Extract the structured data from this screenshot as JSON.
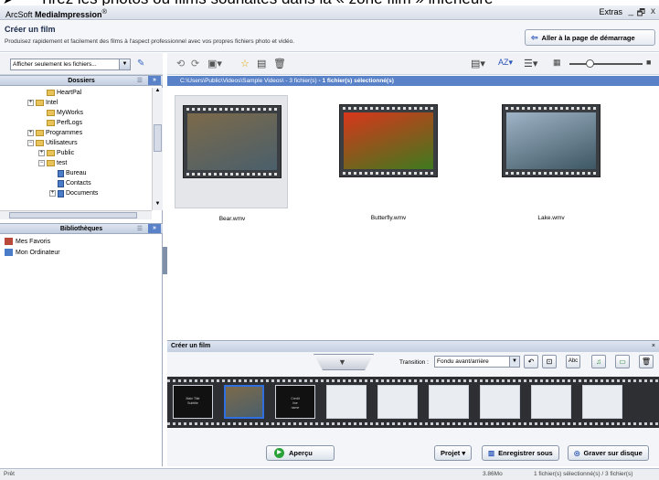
{
  "caption": {
    "bullet": "➤",
    "text": "Tirez les photos ou films souhaités dans la « zone film » inférieure"
  },
  "window": {
    "app_name_prefix": "ArcSoft ",
    "app_name_bold": "MediaImpression",
    "trademark": "®",
    "extras_label": "Extras",
    "minimize": "_",
    "restore": "🗗",
    "close": "x"
  },
  "header": {
    "title": "Créer un film",
    "subtitle": "Produisez rapidement et facilement des films à l'aspect professionnel avec vos propres fichiers photo et vidéo.",
    "home_button": "Aller à la page de démarrage"
  },
  "sidebar": {
    "filter_value": "Afficher seulement les fichiers...",
    "folders_title": "Dossiers",
    "tree": [
      {
        "label": "HeartPal",
        "expand": "",
        "icon": "folder"
      },
      {
        "label": "Intel",
        "expand": "+",
        "icon": "folder"
      },
      {
        "label": "MyWorks",
        "expand": "",
        "icon": "folder"
      },
      {
        "label": "PerfLogs",
        "expand": "",
        "icon": "folder"
      },
      {
        "label": "Programmes",
        "expand": "+",
        "icon": "folder"
      },
      {
        "label": "Utilisateurs",
        "expand": "−",
        "icon": "folder"
      },
      {
        "label": "Public",
        "expand": "+",
        "icon": "folder"
      },
      {
        "label": "test",
        "expand": "−",
        "icon": "folder"
      },
      {
        "label": "Bureau",
        "expand": "",
        "icon": "doc"
      },
      {
        "label": "Contacts",
        "expand": "",
        "icon": "doc"
      },
      {
        "label": "Documents",
        "expand": "+",
        "icon": "doc"
      }
    ],
    "libraries_title": "Bibliothèques",
    "libraries": [
      {
        "label": "Mes Favoris"
      },
      {
        "label": "Mon Ordinateur"
      }
    ]
  },
  "pathbar": {
    "path": "C:\\Users\\Public\\Videos\\Sample Videos\\ - 3 fichier(s)",
    "selection": "- 1 fichier(s) sélectionné(s)"
  },
  "media": [
    {
      "name": "Bear.wmv",
      "selected": true,
      "colors": [
        "#7c6a4a",
        "#4a5f6b"
      ]
    },
    {
      "name": "Butterfly.wmv",
      "selected": false,
      "colors": [
        "#d8361b",
        "#3e7a1e"
      ]
    },
    {
      "name": "Lake.wmv",
      "selected": false,
      "colors": [
        "#9fb4c6",
        "#3e5764"
      ]
    }
  ],
  "film_panel": {
    "title": "Créer un film",
    "close": "×",
    "transition_label": "Transition :",
    "transition_value": "Fondu avant/arrière",
    "slots": [
      {
        "type": "dark",
        "text": "Main Title\nSubtitle"
      },
      {
        "type": "clip",
        "text": ""
      },
      {
        "type": "dark",
        "text": "Credit\nline\nname"
      },
      {
        "type": "empty",
        "text": ""
      },
      {
        "type": "empty",
        "text": ""
      },
      {
        "type": "empty",
        "text": ""
      },
      {
        "type": "empty",
        "text": ""
      },
      {
        "type": "empty",
        "text": ""
      },
      {
        "type": "empty",
        "text": ""
      }
    ],
    "preview_button": "Aperçu",
    "project_button": "Projet ▾",
    "save_button": "Enregistrer sous",
    "burn_button": "Graver sur disque"
  },
  "statusbar": {
    "left": "Prêt",
    "size": "3.86Mo",
    "selection": "1 fichier(s) sélectionné(s) / 3 fichier(s)"
  },
  "colors": {
    "accent": "#5a82c8",
    "selection_border": "#2f6fe0",
    "preview_green": "#2aa23a"
  }
}
